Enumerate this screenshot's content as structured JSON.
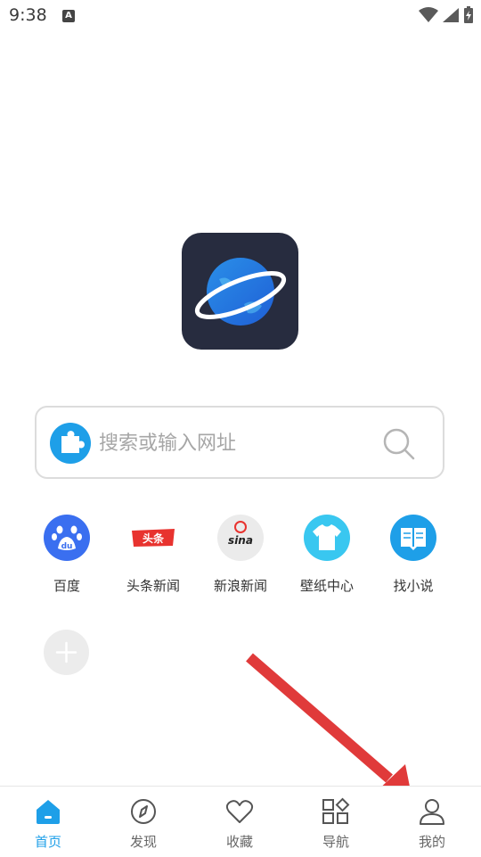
{
  "status_bar": {
    "time": "9:38",
    "notification_icon": "A"
  },
  "logo": {
    "icon": "planet-browser-logo"
  },
  "search": {
    "placeholder": "搜索或输入网址"
  },
  "shortcuts": [
    {
      "label": "百度",
      "icon": "baidu-icon",
      "icon_text": "du",
      "color": "#3a6ff0"
    },
    {
      "label": "头条新闻",
      "icon": "toutiao-icon",
      "icon_text": "头条",
      "color": "#e8332f"
    },
    {
      "label": "新浪新闻",
      "icon": "sina-icon",
      "icon_text": "sina",
      "color": "#e6e6e6"
    },
    {
      "label": "壁纸中心",
      "icon": "tshirt-icon",
      "color": "#39c7f0"
    },
    {
      "label": "找小说",
      "icon": "book-icon",
      "color": "#1e9fe8"
    }
  ],
  "nav": [
    {
      "label": "首页",
      "icon": "home-icon",
      "active": true
    },
    {
      "label": "发现",
      "icon": "compass-icon"
    },
    {
      "label": "收藏",
      "icon": "heart-icon"
    },
    {
      "label": "导航",
      "icon": "grid-icon"
    },
    {
      "label": "我的",
      "icon": "user-icon"
    }
  ],
  "colors": {
    "accent": "#1e9fe8",
    "arrow": "#e03a3a",
    "logo_bg": "#272c3f"
  }
}
